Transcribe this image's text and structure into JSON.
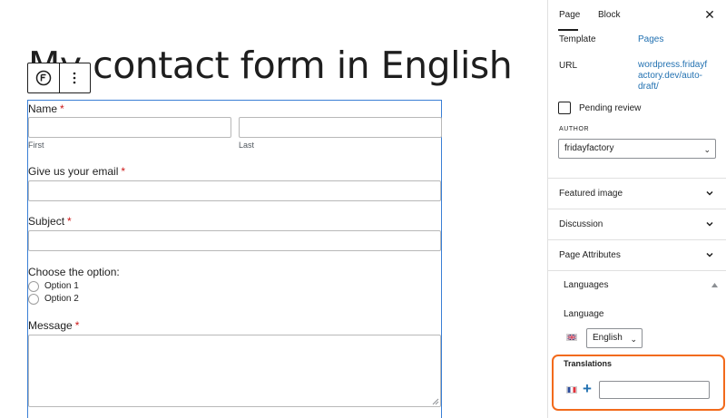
{
  "editor": {
    "page_title": "My contact form in English",
    "form": {
      "name_label": "Name",
      "required_mark": "*",
      "first_sublabel": "First",
      "last_sublabel": "Last",
      "email_label": "Give us your email",
      "subject_label": "Subject",
      "choose_label": "Choose the option:",
      "options": [
        "Option 1",
        "Option 2"
      ],
      "message_label": "Message"
    }
  },
  "sidebar": {
    "tabs": [
      "Page",
      "Block"
    ],
    "close_icon": "close-icon",
    "template_label": "Template",
    "template_value": "Pages",
    "url_label": "URL",
    "url_lines": [
      "wordpress.fridayf",
      "actory.dev/auto-",
      "draft/"
    ],
    "pending_review_label": "Pending review",
    "author_label": "AUTHOR",
    "author_value": "fridayfactory",
    "panels": [
      "Featured image",
      "Discussion",
      "Page Attributes"
    ],
    "languages_title": "Languages",
    "language_label": "Language",
    "language_value": "English",
    "translations_label": "Translations",
    "colors": {
      "link": "#2271b1",
      "highlight": "#f26a1b",
      "block_border": "#3a7fd5",
      "required": "#cc1818"
    }
  }
}
